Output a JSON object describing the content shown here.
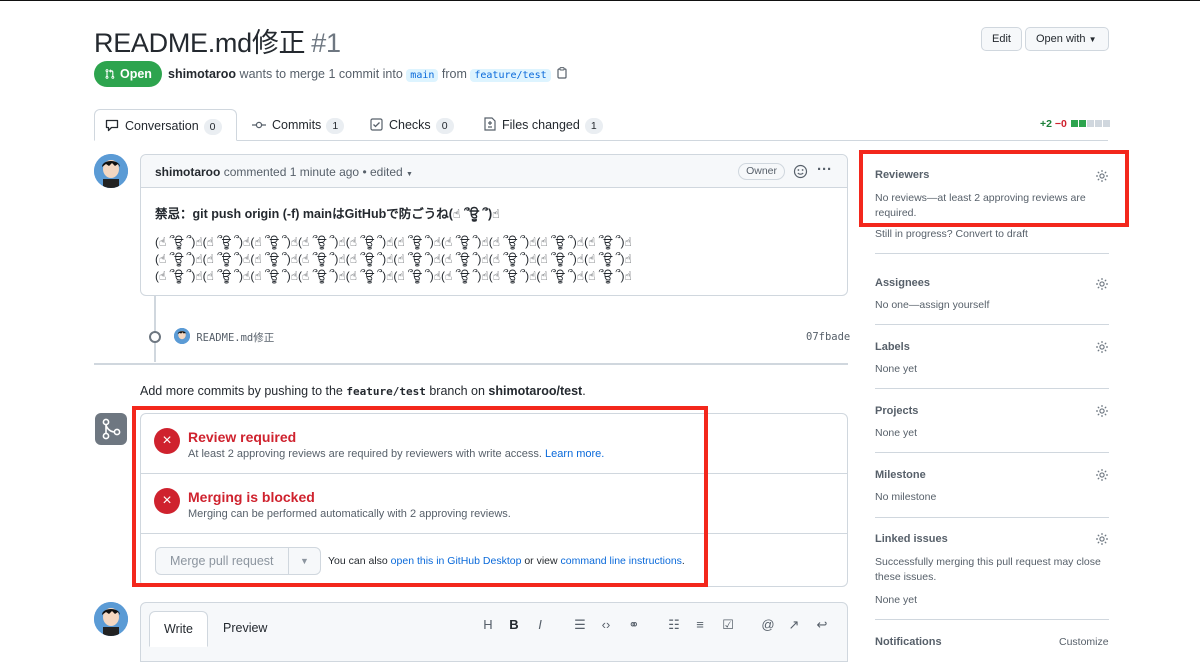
{
  "header": {
    "title": "README.md修正",
    "number": "#1",
    "edit_label": "Edit",
    "open_with_label": "Open with"
  },
  "status": {
    "state": "Open",
    "author": "shimotaroo",
    "action": "wants to merge 1 commit into",
    "base_branch": "main",
    "from": "from",
    "head_branch": "feature/test"
  },
  "tabs": [
    {
      "label": "Conversation",
      "count": "0"
    },
    {
      "label": "Commits",
      "count": "1"
    },
    {
      "label": "Checks",
      "count": "0"
    },
    {
      "label": "Files changed",
      "count": "1"
    }
  ],
  "diffstat": {
    "additions": "+2",
    "deletions": "−0"
  },
  "comment": {
    "author": "shimotaroo",
    "action": "commented 1 minute ago",
    "edited": "• edited",
    "badge": "Owner",
    "line1": "禁忌：git push origin (-f) mainはGitHubで防ごうね(☝ ՞ਊ ՞)☝",
    "line2": "(☝ ՞ਊ ՞)☝(☝ ՞ਊ ՞)☝(☝ ՞ਊ ՞)☝(☝ ՞ਊ ՞)☝(☝ ՞ਊ ՞)☝(☝ ՞ਊ ՞)☝(☝ ՞ਊ ՞)☝(☝ ՞ਊ ՞)☝(☝ ՞ਊ ՞)☝(☝ ՞ਊ ՞)☝",
    "line3": "(☝ ՞ਊ ՞)☝(☝ ՞ਊ ՞)☝(☝ ՞ਊ ՞)☝(☝ ՞ਊ ՞)☝(☝ ՞ਊ ՞)☝(☝ ՞ਊ ՞)☝(☝ ՞ਊ ՞)☝(☝ ՞ਊ ՞)☝(☝ ՞ਊ ՞)☝(☝ ՞ਊ ՞)☝",
    "line4": "(☝ ՞ਊ ՞)☝(☝ ՞ਊ ՞)☝(☝ ՞ਊ ՞)☝(☝ ՞ਊ ՞)☝(☝ ՞ਊ ՞)☝(☝ ՞ਊ ՞)☝(☝ ՞ਊ ՞)☝(☝ ՞ਊ ՞)☝(☝ ՞ਊ ՞)☝(☝ ՞ਊ ՞)☝"
  },
  "commit": {
    "message": "README.md修正",
    "sha": "07fbade"
  },
  "hint": {
    "prefix": "Add more commits by pushing to the",
    "branch": "feature/test",
    "middle": "branch on",
    "repo": "shimotaroo/test",
    "suffix": "."
  },
  "merge": {
    "review_title": "Review required",
    "review_desc": "At least 2 approving reviews are required by reviewers with write access.",
    "learn_more": "Learn more.",
    "blocked_title": "Merging is blocked",
    "blocked_desc": "Merging can be performed automatically with 2 approving reviews.",
    "button": "Merge pull request",
    "alt_prefix": "You can also",
    "alt_link1": "open this in GitHub Desktop",
    "alt_middle": "or view",
    "alt_link2": "command line instructions",
    "alt_suffix": "."
  },
  "editor": {
    "write": "Write",
    "preview": "Preview"
  },
  "sidebar": {
    "reviewers": {
      "title": "Reviewers",
      "value": "No reviews—at least 2 approving reviews are required.",
      "extra": "Still in progress? Convert to draft"
    },
    "assignees": {
      "title": "Assignees",
      "value": "No one—assign yourself"
    },
    "labels": {
      "title": "Labels",
      "value": "None yet"
    },
    "projects": {
      "title": "Projects",
      "value": "None yet"
    },
    "milestone": {
      "title": "Milestone",
      "value": "No milestone"
    },
    "linked": {
      "title": "Linked issues",
      "value": "Successfully merging this pull request may close these issues.",
      "extra": "None yet"
    },
    "notifications": {
      "title": "Notifications",
      "action": "Customize"
    }
  },
  "colors": {
    "open_green": "#2da44e",
    "danger_red": "#cf222e",
    "highlight_red": "#f3271c",
    "link_blue": "#0969da"
  }
}
